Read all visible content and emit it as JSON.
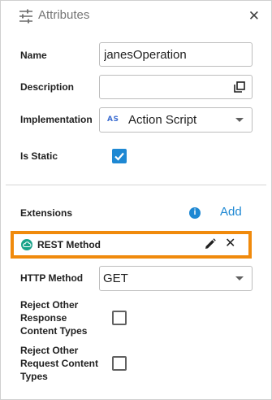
{
  "header": {
    "title": "Attributes",
    "close_glyph": "✕"
  },
  "form": {
    "name_label": "Name",
    "name_value": "janesOperation",
    "description_label": "Description",
    "description_value": "",
    "implementation_label": "Implementation",
    "implementation_icon_text": "AS",
    "implementation_value": "Action Script",
    "is_static_label": "Is Static",
    "is_static_checked": true
  },
  "extensions": {
    "label": "Extensions",
    "info_glyph": "i",
    "add_label": "Add",
    "item_label": "REST Method",
    "edit_glyph": "",
    "remove_glyph": "✕"
  },
  "rest": {
    "http_method_label": "HTTP Method",
    "http_method_value": "GET",
    "reject_response_label": [
      "Reject Other",
      "Response",
      "Content Types"
    ],
    "reject_request_label": [
      "Reject Other",
      "Request Content",
      "Types"
    ],
    "reject_response_checked": false,
    "reject_request_checked": false
  },
  "colors": {
    "accent": "#1e88d3",
    "highlight_outline": "#f08a0c",
    "rest_icon": "#1aa38a"
  }
}
